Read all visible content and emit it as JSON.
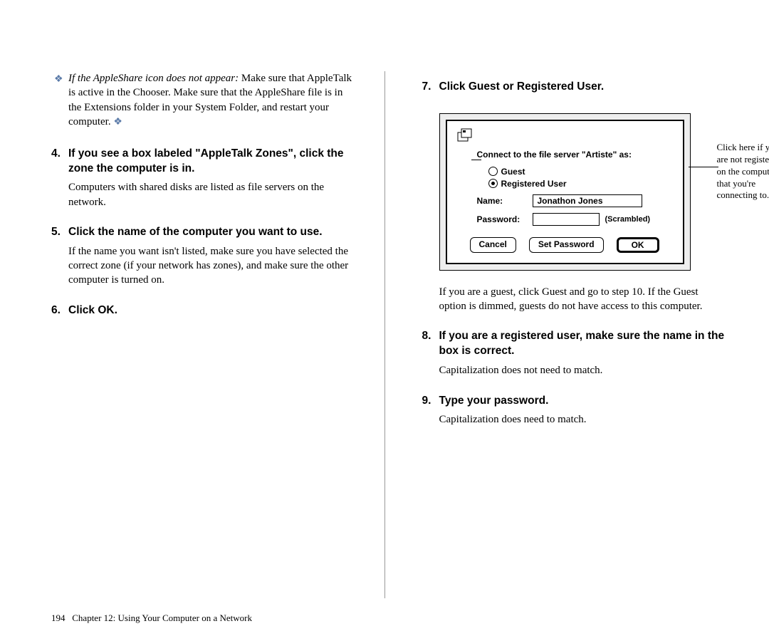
{
  "left": {
    "tip_lead": "If the AppleShare icon does not appear:",
    "tip_rest": "  Make sure that AppleTalk is active in the Chooser. Make sure that the AppleShare file is in the Extensions folder in your System Folder, and restart your computer.  ",
    "step4_num": "4.",
    "step4_heading": "If you see a box labeled \"AppleTalk Zones\", click the zone the computer is in.",
    "step4_body": "Computers with shared disks are listed as file servers on the network.",
    "step5_num": "5.",
    "step5_heading": "Click the name of the computer you want to use.",
    "step5_body": "If the name you want isn't listed, make sure you have selected the correct zone (if your network has zones), and make sure the other computer is turned on.",
    "step6_num": "6.",
    "step6_heading": "Click OK."
  },
  "right": {
    "step7_num": "7.",
    "step7_heading": "Click Guest or Registered User.",
    "post7": "If you are a guest, click Guest and go to step 10. If the Guest option is dimmed, guests do not have access to this computer.",
    "step8_num": "8.",
    "step8_heading": "If you are a registered user, make sure the name in the box is correct.",
    "step8_body": "Capitalization does not need to match.",
    "step9_num": "9.",
    "step9_heading": "Type your password.",
    "step9_body": "Capitalization does need to match."
  },
  "dialog": {
    "title": "Connect to the file server \"Artiste\" as:",
    "guest_label": "Guest",
    "registered_label": "Registered User",
    "name_label": "Name:",
    "name_value": "Jonathon Jones",
    "password_label": "Password:",
    "scrambled": "(Scrambled)",
    "cancel": "Cancel",
    "set_password": "Set Password",
    "ok": "OK"
  },
  "callout": "Click here if you are not registered on the computer that you're connecting to.",
  "footer_page": "194",
  "footer_text": "Chapter 12: Using Your Computer on a Network"
}
